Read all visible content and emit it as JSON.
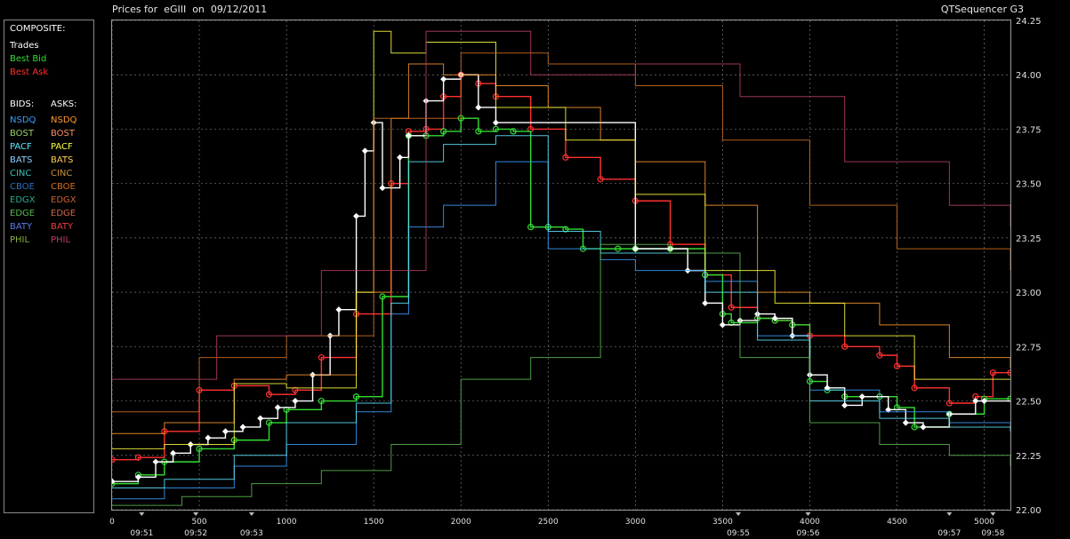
{
  "header": {
    "title": "Prices for  eGIII  on  09/12/2011",
    "app_name": "QTSequencer G3"
  },
  "legend": {
    "composite_header": "COMPOSITE:",
    "composite": [
      {
        "label": "Trades",
        "color": "#ffffff"
      },
      {
        "label": "Best Bid",
        "color": "#33dd33"
      },
      {
        "label": "Best Ask",
        "color": "#ff3030"
      }
    ],
    "bids_header": "BIDS:",
    "asks_header": "ASKS:",
    "bids": [
      {
        "label": "NSDQ",
        "color": "#3aa0ff"
      },
      {
        "label": "BOST",
        "color": "#9bd36a"
      },
      {
        "label": "PACF",
        "color": "#5fe8ff"
      },
      {
        "label": "BATS",
        "color": "#8fd0ff"
      },
      {
        "label": "CINC",
        "color": "#38c0b8"
      },
      {
        "label": "CBOE",
        "color": "#2a70c8"
      },
      {
        "label": "EDGX",
        "color": "#2aa890"
      },
      {
        "label": "EDGE",
        "color": "#5ab850"
      },
      {
        "label": "BATY",
        "color": "#5a7ae8"
      },
      {
        "label": "PHIL",
        "color": "#8ab040"
      }
    ],
    "asks": [
      {
        "label": "NSDQ",
        "color": "#ff9a30"
      },
      {
        "label": "BOST",
        "color": "#ff9060"
      },
      {
        "label": "PACF",
        "color": "#ffff40"
      },
      {
        "label": "BATS",
        "color": "#ffd050"
      },
      {
        "label": "CINC",
        "color": "#c89040"
      },
      {
        "label": "CBOE",
        "color": "#d07020"
      },
      {
        "label": "EDGX",
        "color": "#c86030"
      },
      {
        "label": "EDGE",
        "color": "#d06848"
      },
      {
        "label": "BATY",
        "color": "#e84040"
      },
      {
        "label": "PHIL",
        "color": "#b84060"
      }
    ]
  },
  "chart_data": {
    "type": "line",
    "title": "Prices for  eGIII  on  09/12/2011",
    "xlabel": "",
    "ylabel": "",
    "xlim": [
      0,
      5150
    ],
    "ylim": [
      22.0,
      24.25
    ],
    "grid": true,
    "legend_position": "left-panel",
    "y_ticks": [
      "22.00",
      "22.25",
      "22.50",
      "22.75",
      "23.00",
      "23.25",
      "23.50",
      "23.75",
      "24.00",
      "24.25"
    ],
    "x_ticks": [
      "0",
      "500",
      "1000",
      "1500",
      "2000",
      "2500",
      "3000",
      "3500",
      "4000",
      "4500",
      "5000"
    ],
    "time_ticks": [
      {
        "x": 170,
        "label": "09:51"
      },
      {
        "x": 480,
        "label": "09:52"
      },
      {
        "x": 800,
        "label": "09:53"
      },
      {
        "x": 3590,
        "label": "09:55"
      },
      {
        "x": 3990,
        "label": "09:56"
      },
      {
        "x": 4800,
        "label": "09:57"
      },
      {
        "x": 5050,
        "label": "09:58"
      }
    ],
    "series": [
      {
        "name": "Best Ask",
        "color": "#ff3030",
        "x": [
          0,
          150,
          300,
          500,
          700,
          900,
          1050,
          1200,
          1400,
          1600,
          1700,
          1800,
          1900,
          2000,
          2100,
          2200,
          2400,
          2600,
          2800,
          3000,
          3200,
          3400,
          3550,
          3700,
          3800,
          3900,
          4000,
          4200,
          4400,
          4500,
          4600,
          4800,
          4950,
          5050,
          5150
        ],
        "y": [
          22.23,
          22.24,
          22.36,
          22.55,
          22.57,
          22.53,
          22.55,
          22.7,
          22.9,
          23.5,
          23.74,
          23.75,
          23.9,
          24.0,
          23.96,
          23.9,
          23.75,
          23.62,
          23.52,
          23.42,
          23.22,
          23.08,
          22.93,
          22.88,
          22.87,
          22.85,
          22.8,
          22.75,
          22.71,
          22.66,
          22.56,
          22.49,
          22.52,
          22.63,
          22.63
        ]
      },
      {
        "name": "Best Bid",
        "color": "#33dd33",
        "x": [
          0,
          150,
          300,
          500,
          700,
          900,
          1000,
          1200,
          1400,
          1550,
          1700,
          1800,
          1900,
          2000,
          2100,
          2200,
          2300,
          2400,
          2500,
          2600,
          2700,
          2900,
          3000,
          3200,
          3400,
          3500,
          3550,
          3700,
          3800,
          3900,
          4000,
          4100,
          4200,
          4400,
          4500,
          4600,
          4800,
          5000,
          5150
        ],
        "y": [
          22.12,
          22.16,
          22.22,
          22.28,
          22.32,
          22.4,
          22.46,
          22.5,
          22.52,
          22.98,
          23.72,
          23.72,
          23.74,
          23.8,
          23.74,
          23.75,
          23.74,
          23.3,
          23.3,
          23.29,
          23.2,
          23.2,
          23.2,
          23.2,
          23.08,
          22.9,
          22.86,
          22.88,
          22.87,
          22.85,
          22.59,
          22.55,
          22.52,
          22.52,
          22.47,
          22.38,
          22.44,
          22.51,
          22.51
        ]
      },
      {
        "name": "Trades",
        "color": "#ffffff",
        "x": [
          0,
          150,
          250,
          350,
          450,
          550,
          650,
          750,
          850,
          950,
          1050,
          1150,
          1250,
          1300,
          1400,
          1450,
          1500,
          1550,
          1650,
          1700,
          1800,
          1900,
          2000,
          2100,
          2200,
          3000,
          3200,
          3300,
          3400,
          3500,
          3600,
          3700,
          3800,
          3900,
          4000,
          4100,
          4200,
          4300,
          4450,
          4550,
          4650,
          4800,
          4950,
          5000
        ],
        "y": [
          22.13,
          22.15,
          22.22,
          22.26,
          22.3,
          22.33,
          22.36,
          22.38,
          22.42,
          22.47,
          22.5,
          22.62,
          22.8,
          22.92,
          23.35,
          23.65,
          23.78,
          23.48,
          23.62,
          23.72,
          23.88,
          23.98,
          24.0,
          23.85,
          23.78,
          23.2,
          23.2,
          23.1,
          22.95,
          22.85,
          22.87,
          22.9,
          22.88,
          22.8,
          22.62,
          22.56,
          22.48,
          22.52,
          22.46,
          22.4,
          22.38,
          22.44,
          22.5,
          22.5
        ]
      },
      {
        "name": "NSDQ",
        "color": "#3aa0ff",
        "x": [
          0,
          300,
          700,
          1000,
          1400,
          1600,
          1700,
          1900,
          2200,
          2500,
          2800,
          3000,
          3400,
          3700,
          4000,
          4400,
          4800,
          5150
        ],
        "y": [
          22.05,
          22.1,
          22.2,
          22.3,
          22.45,
          22.9,
          23.3,
          23.4,
          23.6,
          23.2,
          23.15,
          23.1,
          23.05,
          22.8,
          22.55,
          22.45,
          22.4,
          22.38
        ]
      },
      {
        "name": "PACF",
        "color": "#5fe8ff",
        "x": [
          0,
          300,
          700,
          1000,
          1400,
          1600,
          1700,
          1900,
          2200,
          2500,
          2800,
          3000,
          3400,
          3700,
          4000,
          4400,
          4800,
          5150
        ],
        "y": [
          22.1,
          22.14,
          22.25,
          22.4,
          22.49,
          22.95,
          23.6,
          23.68,
          23.72,
          23.28,
          23.18,
          23.18,
          23.0,
          22.78,
          22.5,
          22.42,
          22.38,
          22.36
        ]
      },
      {
        "name": "EDGE",
        "color": "#5ab850",
        "x": [
          0,
          400,
          800,
          1200,
          1600,
          2000,
          2400,
          2800,
          3200,
          3600,
          4000,
          4400,
          4800,
          5150
        ],
        "y": [
          22.02,
          22.06,
          22.12,
          22.18,
          22.3,
          22.6,
          22.7,
          23.22,
          23.18,
          22.7,
          22.4,
          22.3,
          22.25,
          22.2
        ]
      },
      {
        "name": "NSDQ ask",
        "color": "#ff9a30",
        "x": [
          0,
          300,
          700,
          1000,
          1400,
          1600,
          1700,
          1900,
          2200,
          2500,
          2800,
          3000,
          3400,
          3700,
          4000,
          4400,
          4800,
          5150
        ],
        "y": [
          22.35,
          22.4,
          22.6,
          22.62,
          23.0,
          23.8,
          24.05,
          24.0,
          23.95,
          23.85,
          23.7,
          23.6,
          23.4,
          23.0,
          22.95,
          22.85,
          22.7,
          22.65
        ]
      },
      {
        "name": "PACF ask",
        "color": "#ffff40",
        "x": [
          0,
          300,
          700,
          1000,
          1400,
          1500,
          1600,
          1800,
          2200,
          2600,
          3000,
          3400,
          3800,
          4200,
          4600,
          5150
        ],
        "y": [
          22.28,
          22.3,
          22.58,
          22.56,
          23.0,
          24.2,
          24.1,
          24.15,
          23.85,
          23.7,
          23.45,
          23.1,
          22.95,
          22.8,
          22.6,
          22.6
        ]
      },
      {
        "name": "CBOE ask",
        "color": "#d07020",
        "x": [
          0,
          500,
          1000,
          1500,
          2000,
          2500,
          3000,
          3500,
          4000,
          4500,
          5150
        ],
        "y": [
          22.45,
          22.7,
          22.8,
          23.8,
          24.1,
          24.05,
          23.95,
          23.7,
          23.4,
          23.2,
          23.1
        ]
      },
      {
        "name": "PHIL ask",
        "color": "#b84060",
        "x": [
          0,
          600,
          1200,
          1800,
          2400,
          3000,
          3600,
          4200,
          4800,
          5150
        ],
        "y": [
          22.6,
          22.8,
          23.1,
          24.2,
          24.0,
          24.05,
          23.9,
          23.6,
          23.4,
          23.3
        ]
      }
    ]
  }
}
